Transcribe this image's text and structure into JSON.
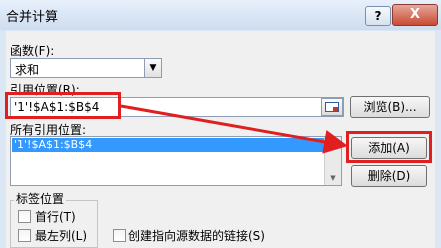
{
  "window": {
    "title": "合并计算",
    "help_label": "?",
    "close_label": "X"
  },
  "function": {
    "label": "函数(F):",
    "value": "求和"
  },
  "reference": {
    "label": "引用位置(R):",
    "value": "'1'!$A$1:$B$4",
    "browse_label": "浏览(B)..."
  },
  "all_references": {
    "label": "所有引用位置:",
    "items": [
      "'1'!$A$1:$B$4"
    ],
    "add_label": "添加(A)",
    "delete_label": "删除(D)"
  },
  "label_position": {
    "group_label": "标签位置",
    "first_row_label": "首行(T)",
    "left_column_label": "最左列(L)",
    "link_label": "创建指向源数据的链接(S)"
  },
  "annotation": {
    "highlight_color": "#e02020"
  }
}
